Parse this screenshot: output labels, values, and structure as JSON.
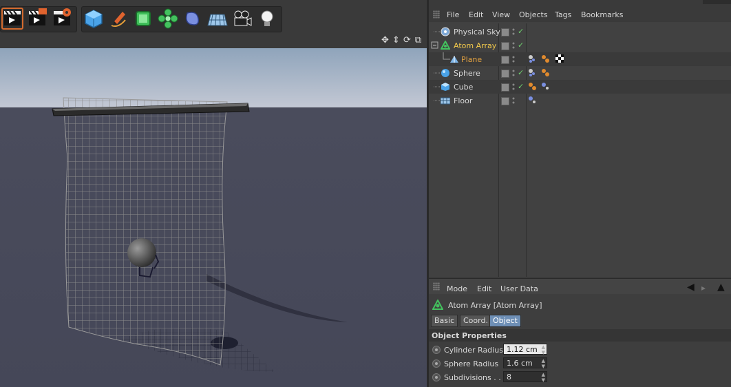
{
  "toolbar": {
    "buttons": [
      {
        "icon": "render-view-icon"
      },
      {
        "icon": "render-picture-viewer-icon"
      },
      {
        "icon": "render-settings-icon"
      },
      {
        "icon": "cube-object-icon"
      },
      {
        "icon": "pen-spline-icon"
      },
      {
        "icon": "subdivision-surface-icon"
      },
      {
        "icon": "array-generator-icon"
      },
      {
        "icon": "deformer-icon"
      },
      {
        "icon": "floor-environment-icon"
      },
      {
        "icon": "camera-icon"
      },
      {
        "icon": "light-icon"
      }
    ]
  },
  "viewport": {
    "nav_icons": [
      "move-view-icon",
      "dolly-view-icon",
      "rotate-view-icon",
      "toggle-view-icon"
    ]
  },
  "object_manager": {
    "menu": [
      "File",
      "Edit",
      "View",
      "Objects",
      "Tags",
      "Bookmarks"
    ],
    "objects": [
      {
        "name": "Physical Sky",
        "icon": "sky-icon",
        "indent": 0,
        "selected": false,
        "check": true,
        "color": "#d8d8d8"
      },
      {
        "name": "Atom Array",
        "icon": "atom-array-icon",
        "indent": 0,
        "selected": true,
        "check": true,
        "color": "#f2c94c"
      },
      {
        "name": "Plane",
        "icon": "plane-icon",
        "indent": 1,
        "selected": false,
        "check": false,
        "color": "#e0a040"
      },
      {
        "name": "Sphere",
        "icon": "sphere-icon",
        "indent": 0,
        "selected": false,
        "check": true,
        "color": "#d8d8d8"
      },
      {
        "name": "Cube",
        "icon": "cube-icon",
        "indent": 0,
        "selected": false,
        "check": true,
        "color": "#d8d8d8"
      },
      {
        "name": "Floor",
        "icon": "floor-icon",
        "indent": 0,
        "selected": false,
        "check": false,
        "color": "#d8d8d8"
      }
    ]
  },
  "attribute_manager": {
    "menu": [
      "Mode",
      "Edit",
      "User Data"
    ],
    "object_title": "Atom Array [Atom Array]",
    "tabs": [
      "Basic",
      "Coord.",
      "Object"
    ],
    "active_tab": "Object",
    "section_title": "Object Properties",
    "properties": [
      {
        "label": "Cylinder Radius",
        "value": "1.12 cm",
        "focused": true
      },
      {
        "label": "Sphere Radius",
        "value": "1.6 cm",
        "focused": false
      },
      {
        "label": "Subdivisions . .",
        "value": "8",
        "focused": false
      }
    ]
  },
  "colors": {
    "accent": "#6e8fb6",
    "selected_text": "#f2c94c",
    "check": "#6fcf6f"
  }
}
